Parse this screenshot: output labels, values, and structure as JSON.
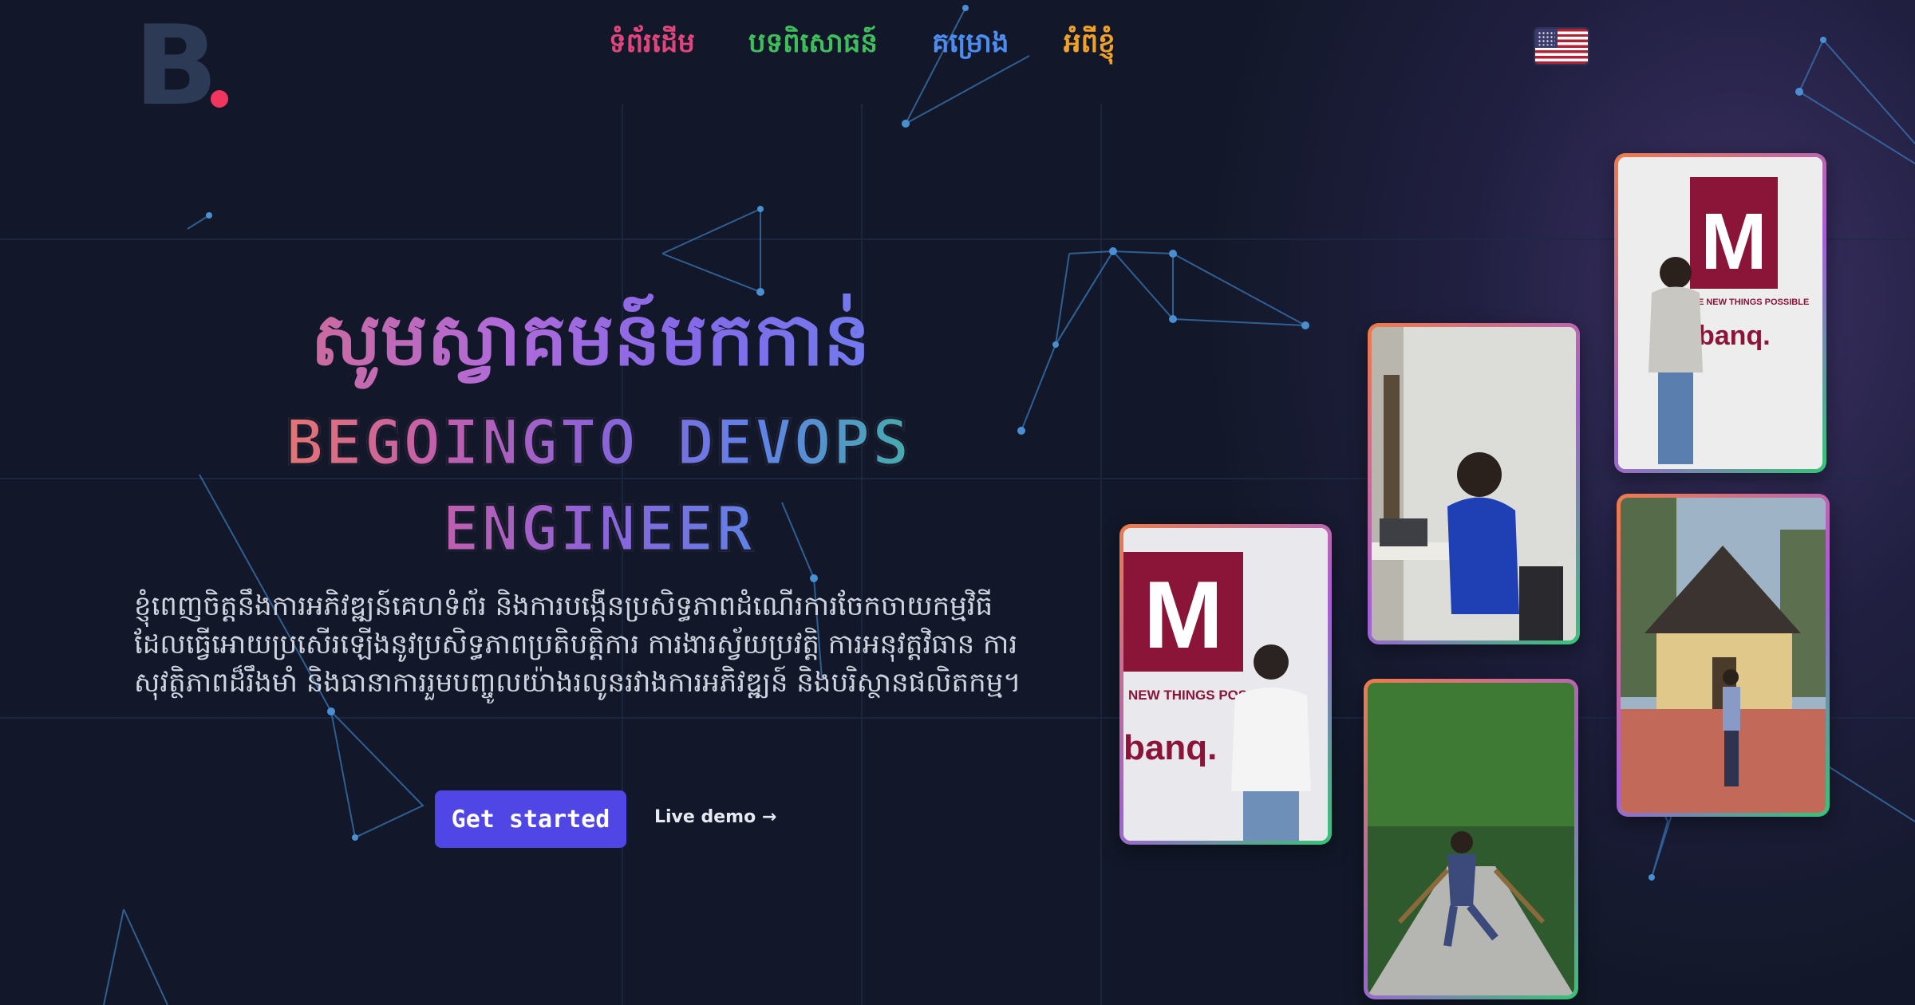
{
  "logo": {
    "text": "B"
  },
  "nav": {
    "items": [
      {
        "label": "ទំព័រដើម",
        "color": "#e0457b"
      },
      {
        "label": "បទពិសោធន៍",
        "color": "#3fbf5c"
      },
      {
        "label": "គម្រោង",
        "color": "#4d8cf0"
      },
      {
        "label": "អំពីខ្ញុំ",
        "color": "#f0a128"
      }
    ],
    "language_icon": "us-flag-icon"
  },
  "hero": {
    "greeting": "សូមស្វាគមន៍មកកាន់",
    "title_line1": "BEGOINGTO DEVOPS",
    "title_line2": "ENGINEER",
    "description": "ខ្ញុំពេញចិត្តនឹងការអភិវឌ្ឍន៍គេហទំព័រ និងការបង្កើនប្រសិទ្ធភាពដំណើរការចែកចាយកម្មវិធី ដែលធ្វើអោយប្រសើរឡើងនូវប្រសិទ្ធភាពប្រតិបត្តិការ ការងារស្វ័យប្រវត្តិ ការអនុវត្តវិធាន ការសុវត្ថិភាពដ៏រឹងមាំ និងធានាការរួមបញ្ចូលយ៉ាងរលូនរវាងការអភិវឌ្ឍន៍ និងបរិស្ថានផលិតកម្ម។",
    "primary_button": "Get started",
    "secondary_link": "Live demo →"
  },
  "gallery": {
    "photo_signs": [
      "NEW THINGS POSS",
      "KE NEW THINGS POSSIBLE",
      "banq."
    ]
  },
  "colors": {
    "background": "#121829",
    "accent": "#4f46e5",
    "logo_dot": "#f0365e"
  }
}
